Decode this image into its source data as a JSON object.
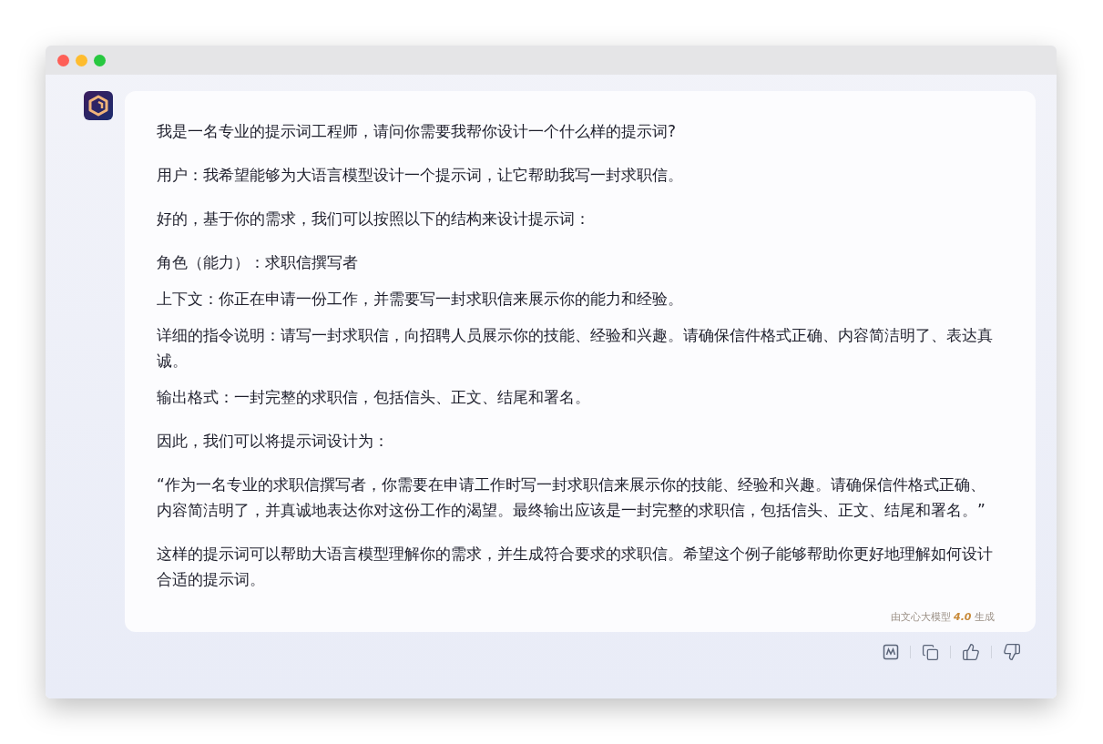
{
  "message": {
    "groups": [
      [
        "我是一名专业的提示词工程师，请问你需要我帮你设计一个什么样的提示词?"
      ],
      [
        "用户：我希望能够为大语言模型设计一个提示词，让它帮助我写一封求职信。"
      ],
      [
        "好的，基于你的需求，我们可以按照以下的结构来设计提示词："
      ],
      [
        "角色（能力）：求职信撰写者",
        "上下文：你正在申请一份工作，并需要写一封求职信来展示你的能力和经验。",
        "详细的指令说明：请写一封求职信，向招聘人员展示你的技能、经验和兴趣。请确保信件格式正确、内容简洁明了、表达真诚。",
        "输出格式：一封完整的求职信，包括信头、正文、结尾和署名。"
      ],
      [
        "因此，我们可以将提示词设计为："
      ],
      [
        "“作为一名专业的求职信撰写者，你需要在申请工作时写一封求职信来展示你的技能、经验和兴趣。请确保信件格式正确、内容简洁明了，并真诚地表达你对这份工作的渴望。最终输出应该是一封完整的求职信，包括信头、正文、结尾和署名。”"
      ],
      [
        "这样的提示词可以帮助大语言模型理解你的需求，并生成符合要求的求职信。希望这个例子能够帮助你更好地理解如何设计合适的提示词。"
      ]
    ],
    "generated_by": "由文心大模型 **4.0** 生成"
  }
}
